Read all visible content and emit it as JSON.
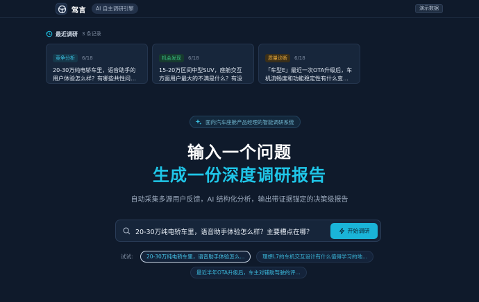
{
  "app": {
    "brand": "驾言",
    "badge": "AI 自主调研引擎",
    "demo_button": "演示数据"
  },
  "recent": {
    "title": "最近调研",
    "count": "3 条记录",
    "cards": [
      {
        "tag": "竞争分析",
        "date": "6/18",
        "text": "20-30万纯电轿车里，语音助手的用户体验怎么样？有哪些共性问…"
      },
      {
        "tag": "机会发现",
        "date": "6/18",
        "text": "15-20万区间中型SUV，座舱交互方面用户最大的不满是什么？有没有…"
      },
      {
        "tag": "质量诊断",
        "date": "6/18",
        "text": "「车型E」最近一次OTA升级后，车机流畅度和功能稳定性有什么变…"
      }
    ]
  },
  "hero": {
    "pill": "面向汽车座舱产品经理的智能调研系统",
    "line1": "输入一个问题",
    "line2": "生成一份深度调研报告",
    "subtitle": "自动采集多源用户反馈，AI 结构化分析，输出带证据锚定的决策级报告"
  },
  "search": {
    "value": "20-30万纯电轿车里，语音助手体验怎么样？主要槽点在哪？",
    "button": "开始调研"
  },
  "suggestions": {
    "label": "试试:",
    "items": [
      "20-30万纯电轿车里，语音助手体验怎么...",
      "理想L7的车机交互设计有什么值得学习的地...",
      "最近半年OTA升级后，车主对辅助驾驶的评..."
    ]
  },
  "colors": {
    "background": "#0f1a2b",
    "accent": "#1fc6e8",
    "tag_competition": "#3cc5e6",
    "tag_opportunity": "#38c07f",
    "tag_quality": "#e7a93b"
  },
  "icons": [
    "steering-wheel-icon",
    "history-icon",
    "sparkle-icon",
    "search-icon",
    "lightning-icon"
  ]
}
